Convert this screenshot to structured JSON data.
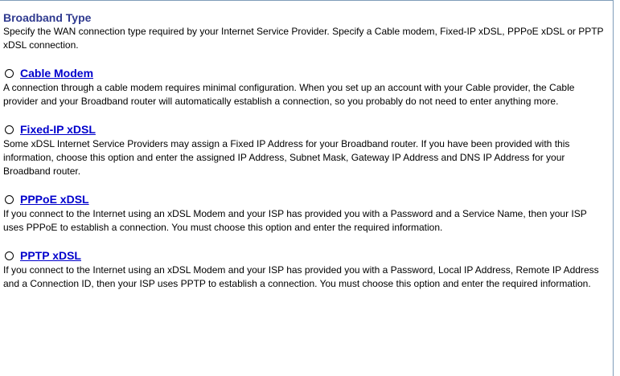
{
  "section": {
    "title": "Broadband Type",
    "description": "Specify the WAN connection type required by your Internet Service Provider. Specify a Cable modem, Fixed-IP xDSL, PPPoE xDSL or PPTP xDSL connection."
  },
  "options": [
    {
      "label": "Cable Modem",
      "description": "A connection through a cable modem requires minimal configuration. When you set up an account with your Cable provider, the Cable provider and your Broadband router will automatically establish a connection, so you probably do not need to enter anything more."
    },
    {
      "label": "Fixed-IP xDSL",
      "description": "Some xDSL Internet Service Providers may assign a Fixed IP Address for your Broadband router. If you have been provided with this information, choose this option and enter the assigned IP Address, Subnet Mask, Gateway IP Address and DNS IP Address for your Broadband router."
    },
    {
      "label": "PPPoE xDSL",
      "description": "If you connect to the Internet using an xDSL Modem and your ISP has provided you with a Password and a Service Name, then your ISP uses PPPoE to establish a connection. You must choose this option and enter the required information."
    },
    {
      "label": "PPTP xDSL",
      "description": "If you connect to the Internet using an xDSL Modem and your ISP has provided you with a Password, Local IP Address, Remote IP Address and a Connection ID, then your ISP uses PPTP to establish a connection. You must choose this option and enter the required information."
    }
  ],
  "colors": {
    "title": "#2f3a8f",
    "link": "#0000cc",
    "border": "#7f9db9"
  }
}
